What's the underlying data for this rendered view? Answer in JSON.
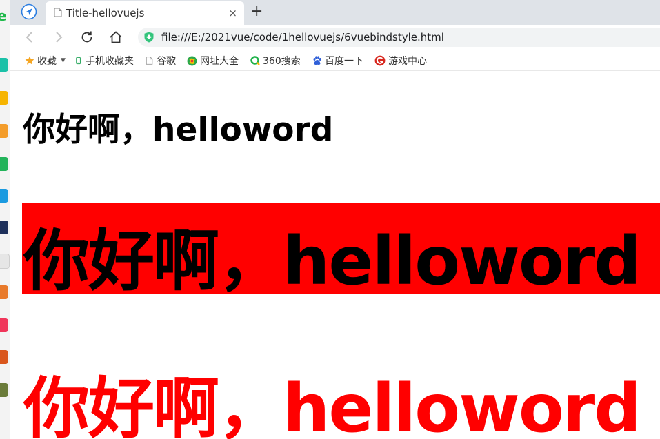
{
  "browser": {
    "tab": {
      "title": "Title-hellovuejs",
      "close_glyph": "×"
    },
    "new_tab_glyph": "+",
    "address": "file:///E:/2021vue/code/1hellovuejs/6vuebindstyle.html"
  },
  "bookmarks": {
    "items": [
      {
        "label": "收藏",
        "icon": "star-icon"
      },
      {
        "label": "手机收藏夹",
        "icon": "phone-icon"
      },
      {
        "label": "谷歌",
        "icon": "page-icon"
      },
      {
        "label": "网址大全",
        "icon": "globe-icon"
      },
      {
        "label": "360搜索",
        "icon": "search-360-icon"
      },
      {
        "label": "百度一下",
        "icon": "baidu-paw-icon"
      },
      {
        "label": "游戏中心",
        "icon": "game-center-icon"
      }
    ]
  },
  "page": {
    "heading_plain": "你好啊，helloword",
    "heading_red_background": "你好啊，helloword",
    "heading_red_text": "你好啊，helloword"
  },
  "colors": {
    "red": "#ff0000",
    "black": "#000000",
    "tabstrip": "#dfe3e8",
    "shield_green": "#34c47c"
  }
}
